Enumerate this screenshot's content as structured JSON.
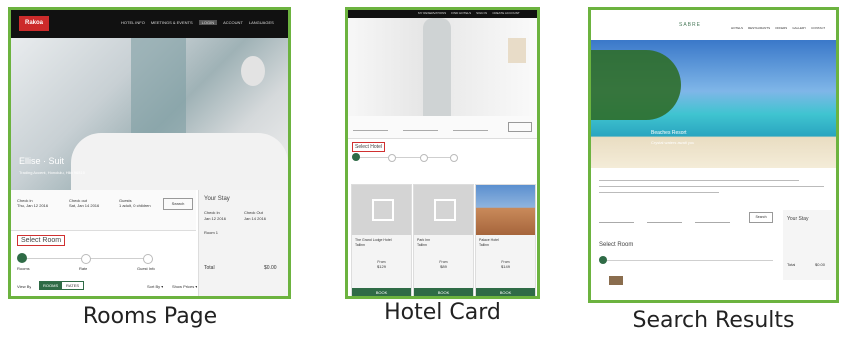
{
  "panels": [
    {
      "caption": "Rooms Page",
      "logo": "Rakoa",
      "nav": [
        "HOTEL INFO",
        "MEETINGS & EVENTS",
        "LOGIN",
        "ACCOUNT",
        "LANGUAGES"
      ],
      "hero_title": "Ellise · Suit",
      "hero_subtitle": "Trading Accent, Honolulu, Hilo 96815",
      "search": {
        "checkin_label": "Check in",
        "checkin_value": "Thu, Jan 12 2016",
        "checkout_label": "Check out",
        "checkout_value": "Sat, Jan 14 2016",
        "guests_label": "Guests",
        "guests_value": "1 adult, 0 children",
        "button": "Search"
      },
      "summary": {
        "title": "Your Stay",
        "checkin": "Check In",
        "checkin_val": "Jan 12 2016",
        "checkout": "Check Out",
        "checkout_val": "Jan 14 2016",
        "room": "Room 1",
        "total_label": "Total",
        "total_value": "$0.00"
      },
      "section_label": "Select Room",
      "steps": [
        "Rooms",
        "Rate",
        "Guest Info"
      ],
      "filter_label": "View By",
      "tab_rooms": "ROOMS",
      "tab_rates": "RATES",
      "sort": "Sort By ▾",
      "show": "Show Prices ▾"
    },
    {
      "caption": "Hotel Card",
      "nav": [
        "MY RESERVATIONS",
        "FIND HOTELS",
        "SIGN IN",
        "CREATE ACCOUNT"
      ],
      "section_label": "Select Hotel",
      "cards": [
        {
          "name": "The Grand Lodge Hotel",
          "sub": "Tallinn",
          "price_label": "From",
          "price": "$129",
          "button": "BOOK"
        },
        {
          "name": "Park Inn",
          "sub": "Tallinn",
          "price_label": "From",
          "price": "$89",
          "button": "BOOK"
        },
        {
          "name": "Palace Hotel",
          "sub": "Tallinn",
          "price_label": "From",
          "price": "$149",
          "button": "BOOK"
        }
      ]
    },
    {
      "caption": "Search Results",
      "logo": "SABRE",
      "nav": [
        "HOTELS",
        "RESTAURANTS",
        "OFFERS",
        "GALLERY",
        "CONTACT"
      ],
      "hero_title": "Beaches Resort",
      "hero_subtitle": "Crystal waters await you",
      "section_label": "Select Room",
      "button": "Search",
      "summary_title": "Your Stay",
      "total_label": "Total",
      "total_value": "$0.00"
    }
  ]
}
